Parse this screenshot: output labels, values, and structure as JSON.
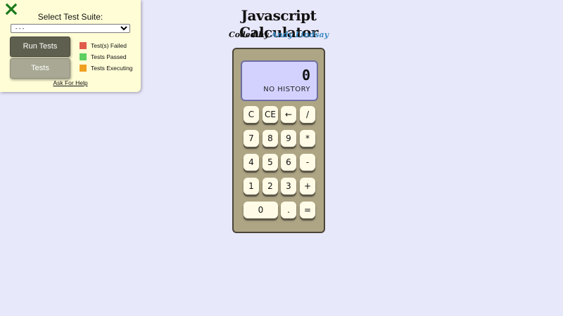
{
  "test_panel": {
    "close_icon": "x-close-icon",
    "suite_label": "Select Test Suite:",
    "suite_selected": "- - -",
    "run_label": "Run Tests",
    "tests_label": "Tests",
    "legend": [
      {
        "label": "Test(s) Failed",
        "color": "#e05a4a"
      },
      {
        "label": "Tests Passed",
        "color": "#5fcf5f"
      },
      {
        "label": "Tests Executing",
        "color": "#f0a020"
      }
    ],
    "help_label": "Ask For Help"
  },
  "header": {
    "title": "Javascript Calculator",
    "coded_by": "Coded by",
    "author": "Andy Lindsay"
  },
  "calculator": {
    "display_value": "0",
    "history": "NO HISTORY",
    "keys": {
      "clear": "C",
      "clear_entry": "CE",
      "backspace": "←",
      "divide": "/",
      "seven": "7",
      "eight": "8",
      "nine": "9",
      "multiply": "*",
      "four": "4",
      "five": "5",
      "six": "6",
      "subtract": "-",
      "one": "1",
      "two": "2",
      "three": "3",
      "add": "+",
      "zero": "0",
      "decimal": ".",
      "equals": "="
    }
  }
}
